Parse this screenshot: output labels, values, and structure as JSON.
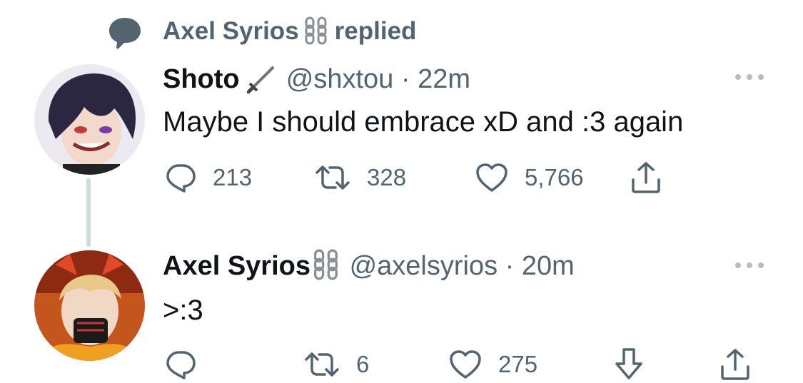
{
  "context": {
    "name": "Axel Syrios",
    "name_emoji": "chain-link-emoji",
    "action": "replied",
    "icon": "speech-bubble-icon"
  },
  "tweets": [
    {
      "display_name": "Shoto",
      "name_emoji": "dagger-emoji",
      "handle": "@shxtou",
      "separator": "·",
      "time": "22m",
      "text": "Maybe I should embrace xD and :3 again",
      "replies": "213",
      "retweets": "328",
      "likes": "5,766",
      "avatar": "dark-haired-anime-avatar",
      "colors": {
        "avatar_bg": "#e9e5ee",
        "hair": "#2b2740"
      }
    },
    {
      "display_name": "Axel Syrios",
      "name_emoji": "chain-link-emoji",
      "handle": "@axelsyrios",
      "separator": "·",
      "time": "20m",
      "text": ">:3",
      "replies": "",
      "retweets": "6",
      "likes": "275",
      "avatar": "blonde-masked-anime-avatar",
      "colors": {
        "avatar_bg": "#c4561d",
        "hair": "#e8c98a"
      }
    }
  ],
  "colors": {
    "text_primary": "#0f1419",
    "text_secondary": "#536471",
    "thread_line": "#cfd9de",
    "icon_gray": "#536471"
  }
}
